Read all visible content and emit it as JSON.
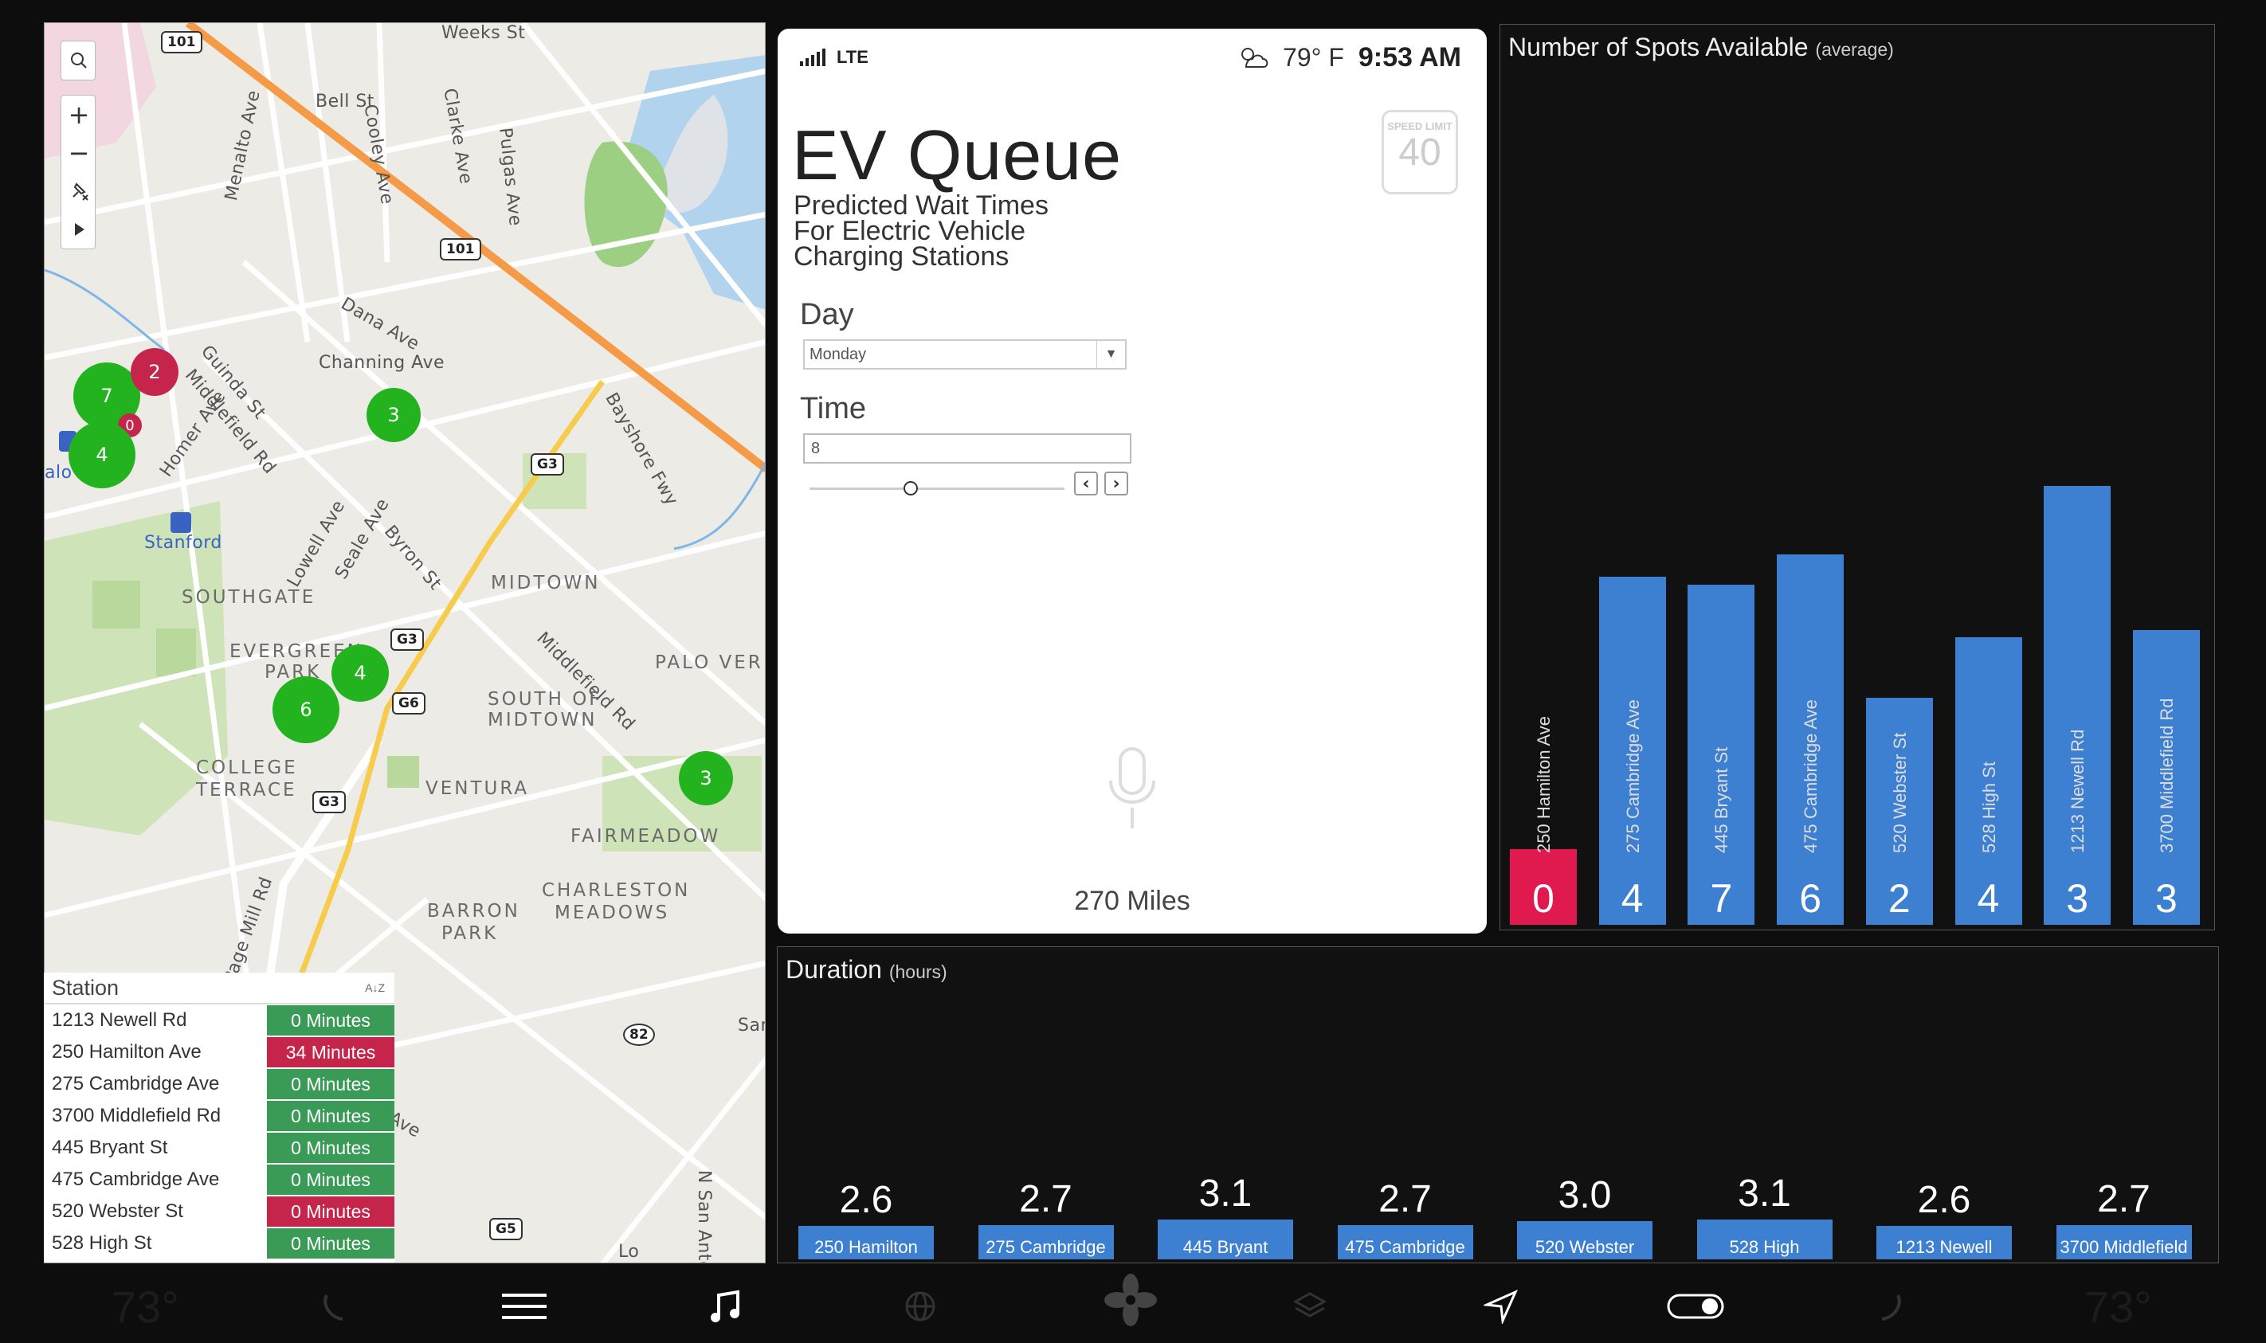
{
  "map": {
    "labels": {
      "weeks_st": "Weeks St",
      "bell_st": "Bell St",
      "coolev_ave": "Cooley Ave",
      "clarke_ave": "Clarke Ave",
      "pulgas_ave": "Pulgas Ave",
      "menalto_ave": "Menalto Ave",
      "dana_ave": "Dana Ave",
      "channing_ave": "Channing Ave",
      "guinda_st": "Guinda St",
      "middlefield_rd_n": "Middlefield Rd",
      "homer_ave": "Homer Ave",
      "bayshore_fwy": "Bayshore Fwy",
      "stanford": "Stanford",
      "southgate": "SOUTHGATE",
      "lowell_ave": "Lowell Ave",
      "seale_ave": "Seale Ave",
      "byron_st": "Byron St",
      "midtown": "MIDTOWN",
      "middlefield_rd_s": "Middlefield Rd",
      "evergreen": "EVERGREEN",
      "park": "PARK",
      "palo_verde": "PALO VERD",
      "south_of_midtown_1": "SOUTH OF",
      "south_of_midtown_2": "MIDTOWN",
      "college": "COLLEGE",
      "terrace": "TERRACE",
      "ventura": "VENTURA",
      "fairmeadow": "FAIRMEADOW",
      "charleston": "CHARLESTON",
      "meadows": "MEADOWS",
      "barron": "BARRON",
      "park2": "PARK",
      "page_mill_rd": "Page Mill Rd",
      "n_san_anto": "N San Anto",
      "ave": "Ave",
      "san": "San",
      "lo": "Lo",
      "alo": "alo"
    },
    "shields": {
      "s101a": "101",
      "s101b": "101",
      "g63a": "G3",
      "g63b": "G3",
      "g63c": "G3",
      "g66": "G6",
      "s82": "82",
      "g65": "G5"
    },
    "clusters": [
      {
        "count": "7",
        "status": "green"
      },
      {
        "count": "2",
        "status": "red"
      },
      {
        "count": "0",
        "status": "red"
      },
      {
        "count": "4",
        "status": "green"
      },
      {
        "count": "3",
        "status": "green"
      },
      {
        "count": "4",
        "status": "green"
      },
      {
        "count": "6",
        "status": "green"
      },
      {
        "count": "3",
        "status": "green"
      }
    ],
    "controls": {
      "zoom_in": "+",
      "zoom_out": "−"
    }
  },
  "stations": {
    "header": "Station",
    "sort_icon": "A↓Z",
    "rows": [
      {
        "name": "1213 Newell Rd",
        "wait": "0 Minutes",
        "status": "ok"
      },
      {
        "name": "250 Hamilton Ave",
        "wait": "34 Minutes",
        "status": "bad"
      },
      {
        "name": "275 Cambridge Ave",
        "wait": "0 Minutes",
        "status": "ok"
      },
      {
        "name": "3700 Middlefield Rd",
        "wait": "0 Minutes",
        "status": "ok"
      },
      {
        "name": "445 Bryant St",
        "wait": "0 Minutes",
        "status": "ok"
      },
      {
        "name": "475 Cambridge Ave",
        "wait": "0 Minutes",
        "status": "ok"
      },
      {
        "name": "520 Webster St",
        "wait": "0 Minutes",
        "status": "bad"
      },
      {
        "name": "528 High St",
        "wait": "0 Minutes",
        "status": "ok"
      }
    ]
  },
  "phone": {
    "network": "LTE",
    "temperature": "79° F",
    "time": "9:53 AM",
    "title": "EV Queue",
    "subtitle": [
      "Predicted Wait Times",
      "For Electric Vehicle",
      "Charging Stations"
    ],
    "speed_limit_label": "SPEED LIMIT",
    "speed_limit_value": "40",
    "day_label": "Day",
    "day_value": "Monday",
    "time_label": "Time",
    "time_value": "8",
    "time_slider_value": 8,
    "range": "270 Miles"
  },
  "spots_chart": {
    "title": "Number of Spots Available",
    "title_note": "(average)"
  },
  "duration_chart": {
    "title": "Duration",
    "title_note": "(hours)"
  },
  "chart_data": [
    {
      "type": "bar",
      "title": "Number of Spots Available (average)",
      "categories": [
        "250 Hamilton Ave",
        "275 Cambridge Ave",
        "445 Bryant St",
        "475 Cambridge Ave",
        "520 Webster St",
        "528 High St",
        "1213 Newell Rd",
        "3700 Middlefield Rd"
      ],
      "values": [
        0,
        4,
        7,
        6,
        2,
        4,
        3,
        3
      ],
      "bar_heights": [
        1.0,
        4.6,
        4.5,
        4.9,
        3.0,
        3.8,
        5.8,
        3.9
      ],
      "ylim": [
        0,
        10
      ],
      "colors": [
        "#e0194f",
        "#3d7fd0",
        "#3d7fd0",
        "#3d7fd0",
        "#3d7fd0",
        "#3d7fd0",
        "#3d7fd0",
        "#3d7fd0"
      ]
    },
    {
      "type": "bar",
      "title": "Duration (hours)",
      "categories": [
        "250 Hamilton",
        "275 Cambridge",
        "445 Bryant",
        "475 Cambridge",
        "520 Webster",
        "528 High",
        "1213 Newell",
        "3700 Middlefield"
      ],
      "values": [
        2.6,
        2.7,
        3.1,
        2.7,
        3.0,
        3.1,
        2.6,
        2.7
      ],
      "value_labels": [
        "2.6",
        "2.7",
        "3.1",
        "2.7",
        "3.0",
        "3.1",
        "2.6",
        "2.7"
      ],
      "ylim": [
        0,
        30
      ],
      "color": "#3d7fd0"
    }
  ],
  "dock": {
    "left_temp": "73°",
    "right_temp": "73°",
    "icons": [
      "phone-icon",
      "menu-icon",
      "music-icon",
      "globe-icon",
      "fan-icon",
      "layers-icon",
      "navigation-icon",
      "toggle-icon",
      "phone-right-icon"
    ]
  },
  "colors": {
    "ok": "#3a9b57",
    "bad": "#c5254a",
    "bar": "#3d7fd0",
    "bar_alert": "#e0194f"
  }
}
